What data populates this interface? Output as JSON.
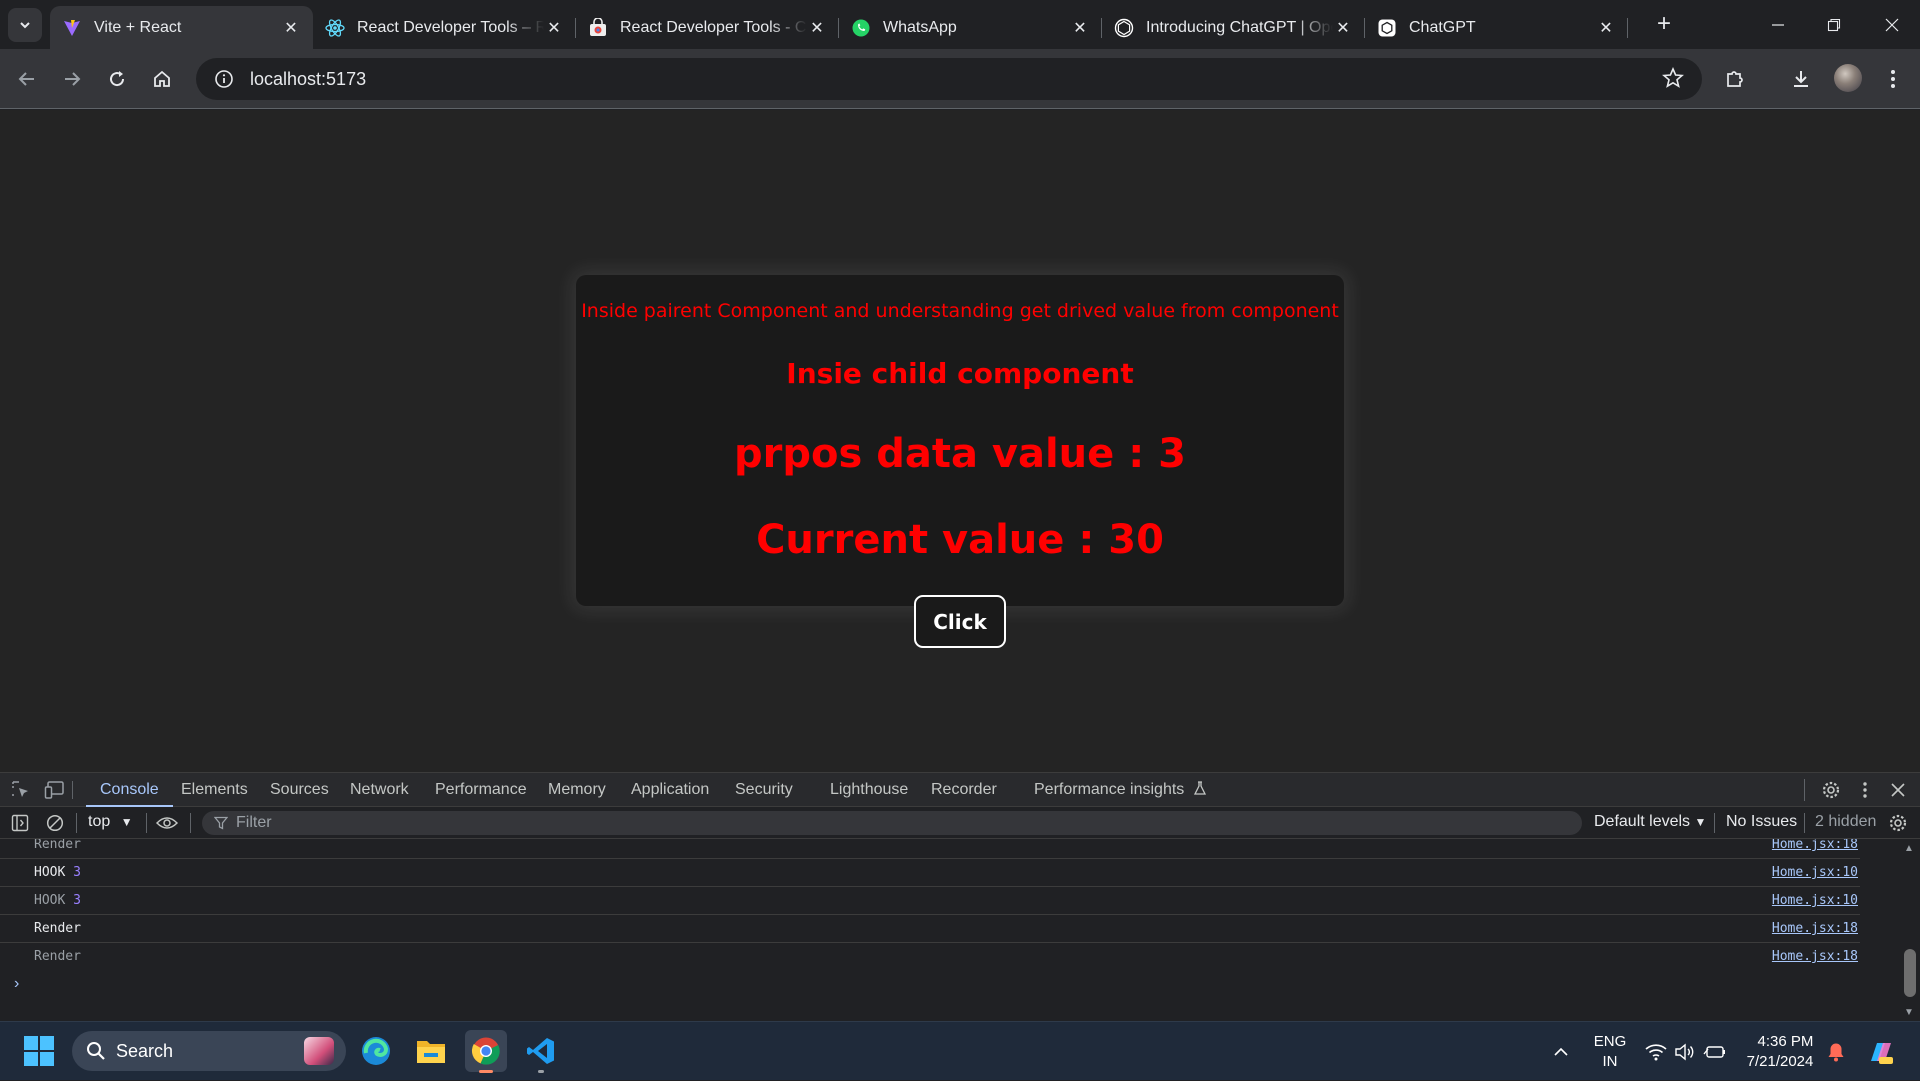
{
  "browser": {
    "tabs": [
      {
        "title": "Vite + React",
        "icon": "vite-icon",
        "active": true
      },
      {
        "title": "React Developer Tools – Re",
        "icon": "react-icon",
        "active": false
      },
      {
        "title": "React Developer Tools - Ch",
        "icon": "chrome-web-store-icon",
        "active": false
      },
      {
        "title": "WhatsApp",
        "icon": "whatsapp-icon",
        "active": false
      },
      {
        "title": "Introducing ChatGPT | Ope",
        "icon": "openai-icon",
        "active": false
      },
      {
        "title": "ChatGPT",
        "icon": "openai-icon",
        "active": false
      }
    ],
    "address": "localhost:5173"
  },
  "page": {
    "parent_text": "Inside pairent Component and understanding get drived value from component",
    "child_heading": "Insie child component",
    "props_text": "prpos data value : 3",
    "current_text": "Current value : 30",
    "button_label": "Click"
  },
  "devtools": {
    "tabs": [
      "Console",
      "Elements",
      "Sources",
      "Network",
      "Performance",
      "Memory",
      "Application",
      "Security",
      "Lighthouse",
      "Recorder",
      "Performance insights"
    ],
    "active_tab": "Console",
    "context": "top",
    "filter_placeholder": "Filter",
    "levels": "Default levels",
    "issues": "No Issues",
    "hidden": "2 hidden",
    "console_rows": [
      {
        "text": "Render",
        "num": "",
        "source": "Home.jsx:18",
        "dim": true
      },
      {
        "text": "HOOK",
        "num": "3",
        "source": "Home.jsx:10",
        "dim": false
      },
      {
        "text": "HOOK",
        "num": "3",
        "source": "Home.jsx:10",
        "dim": true
      },
      {
        "text": "Render",
        "num": "",
        "source": "Home.jsx:18",
        "dim": false
      },
      {
        "text": "Render",
        "num": "",
        "source": "Home.jsx:18",
        "dim": true
      }
    ]
  },
  "taskbar": {
    "search_label": "Search",
    "lang_top": "ENG",
    "lang_bottom": "IN",
    "time": "4:36 PM",
    "date": "7/21/2024"
  },
  "colors": {
    "page_text": "#ff0000",
    "page_bg": "#242424",
    "card_bg": "#1a1a1a",
    "accent": "#a8c7fa"
  }
}
